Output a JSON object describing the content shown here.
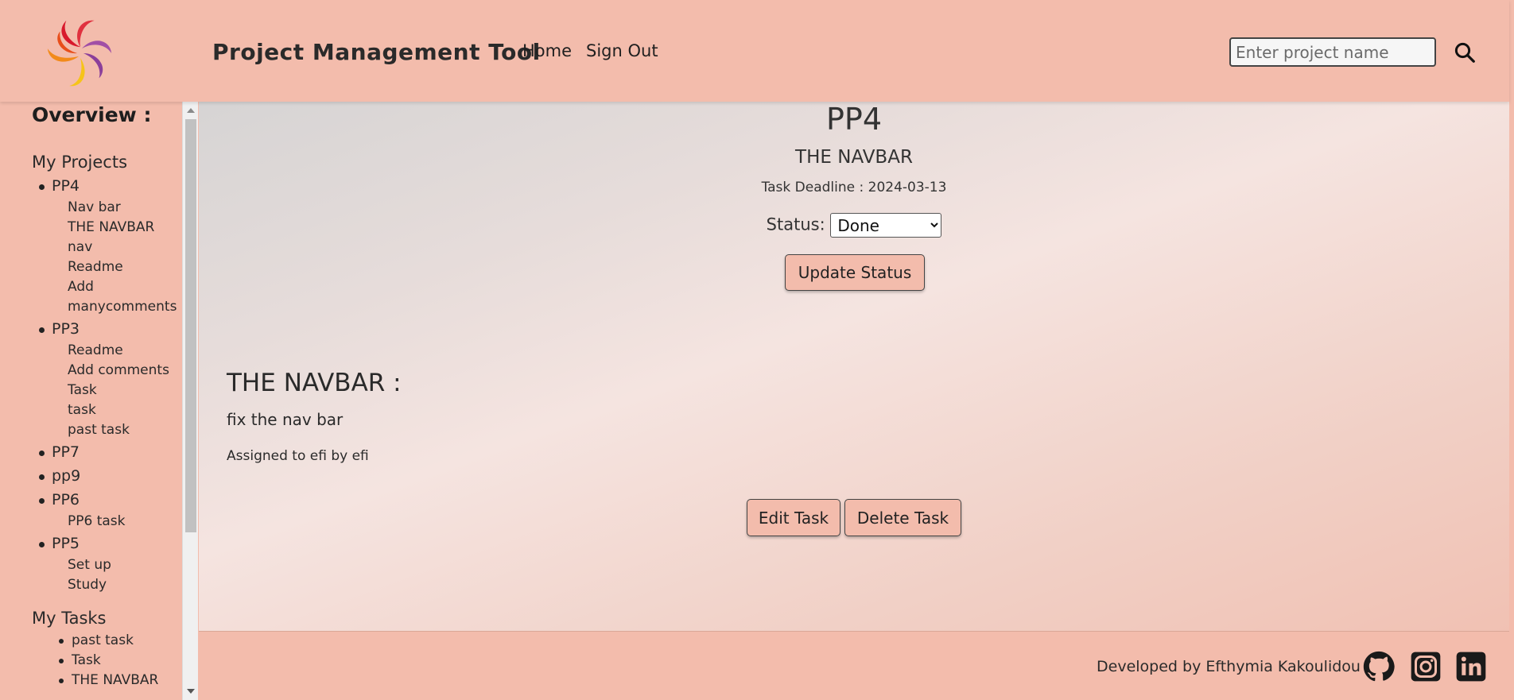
{
  "header": {
    "title": "Project Management Tool",
    "nav": {
      "home": "Home",
      "signout": "Sign Out"
    },
    "search": {
      "placeholder": "Enter project name"
    },
    "colors": {
      "background": "#f3bcac"
    }
  },
  "sidebar": {
    "overview_title": "Overview :",
    "projects_title": "My Projects",
    "projects": [
      {
        "name": "PP4",
        "tasks": [
          "Nav bar",
          "THE NAVBAR",
          "nav",
          "Readme",
          "Add",
          "manycomments"
        ]
      },
      {
        "name": "PP3",
        "tasks": [
          "Readme",
          "Add comments",
          "Task",
          "task",
          "past task"
        ]
      },
      {
        "name": "PP7",
        "tasks": []
      },
      {
        "name": "pp9",
        "tasks": []
      },
      {
        "name": "PP6",
        "tasks": [
          "PP6 task"
        ]
      },
      {
        "name": "PP5",
        "tasks": [
          "Set up",
          "Study"
        ]
      }
    ],
    "tasks_title": "My Tasks",
    "my_tasks": [
      "past task",
      "Task",
      "THE NAVBAR"
    ]
  },
  "main": {
    "project_title": "PP4",
    "task_title": "THE NAVBAR",
    "deadline": "Task Deadline : 2024-03-13",
    "status_label": "Status:",
    "status_value": "Done",
    "update_button": "Update Status",
    "description_heading": "THE NAVBAR :",
    "description": "fix the nav bar",
    "assigned": "Assigned to efi by efi",
    "edit_button": "Edit Task",
    "delete_button": "Delete Task"
  },
  "footer": {
    "credit": "Developed by Efthymia Kakoulidou",
    "icons": [
      "github-icon",
      "instagram-icon",
      "linkedin-icon"
    ]
  }
}
